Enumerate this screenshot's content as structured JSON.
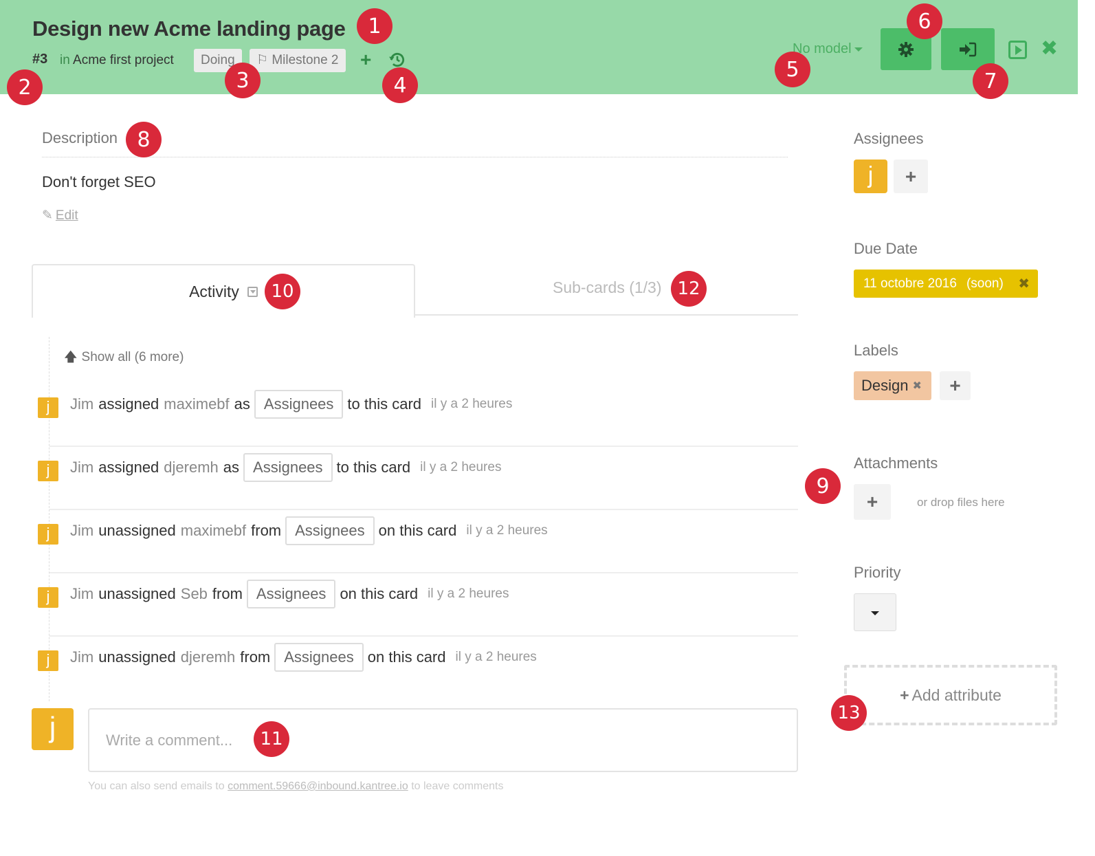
{
  "header": {
    "title": "Design new Acme landing page",
    "card_number": "#3",
    "project_prefix": "in",
    "project_name": "Acme first project",
    "status_tag": "Doing",
    "milestone_icon": "flag-icon",
    "milestone_tag": "Milestone 2",
    "add_icon": "plus-icon",
    "history_icon": "history-icon",
    "model_dropdown": "No model",
    "settings_icon": "gear-icon",
    "move_icon": "sign-in-icon",
    "present_icon": "play-square-icon",
    "close_icon": "close-icon",
    "background_color": "#97d9a8",
    "button_color": "#4cbd69"
  },
  "description": {
    "label": "Description",
    "text": "Don't forget SEO",
    "edit_label": "Edit",
    "edit_icon": "pencil-icon"
  },
  "tabs": [
    {
      "label": "Activity",
      "active": true,
      "icon": "filter-icon"
    },
    {
      "label": "Sub-cards (1/3)",
      "active": false
    }
  ],
  "activity": {
    "show_all": "Show all (6 more)",
    "items": [
      {
        "avatar": "j",
        "actor": "Jim",
        "verb": "assigned",
        "target": "maximebf",
        "prep": "as",
        "chip": "Assignees",
        "tail": "to this card",
        "time": "il y a 2 heures"
      },
      {
        "avatar": "j",
        "actor": "Jim",
        "verb": "assigned",
        "target": "djeremh",
        "prep": "as",
        "chip": "Assignees",
        "tail": "to this card",
        "time": "il y a 2 heures"
      },
      {
        "avatar": "j",
        "actor": "Jim",
        "verb": "unassigned",
        "target": "maximebf",
        "prep": "from",
        "chip": "Assignees",
        "tail": "on this card",
        "time": "il y a 2 heures"
      },
      {
        "avatar": "j",
        "actor": "Jim",
        "verb": "unassigned",
        "target": "Seb",
        "prep": "from",
        "chip": "Assignees",
        "tail": "on this card",
        "time": "il y a 2 heures"
      },
      {
        "avatar": "j",
        "actor": "Jim",
        "verb": "unassigned",
        "target": "djeremh",
        "prep": "from",
        "chip": "Assignees",
        "tail": "on this card",
        "time": "il y a 2 heures"
      }
    ]
  },
  "comment": {
    "avatar": "j",
    "placeholder": "Write a comment...",
    "value": "",
    "hint_prefix": "You can also send emails to",
    "hint_email": "comment.59666@inbound.kantree.io",
    "hint_suffix": "to leave comments"
  },
  "sidebar": {
    "assignees_label": "Assignees",
    "assignee_avatar": "j",
    "add_assignee": "+",
    "due_date_label": "Due Date",
    "due_date": "11 octobre 2016",
    "due_status": "(soon)",
    "due_remove": "✖",
    "due_color": "#e6c200",
    "labels_label": "Labels",
    "labels": [
      {
        "text": "Design",
        "color": "#f2c6a1",
        "remove": "✖"
      }
    ],
    "add_label": "+",
    "attachments_label": "Attachments",
    "add_attachment": "+",
    "drop_hint": "or drop files here",
    "priority_label": "Priority",
    "priority_value": "",
    "add_attribute": "Add attribute",
    "add_attribute_icon": "+"
  },
  "annotations": [
    "1",
    "2",
    "3",
    "4",
    "5",
    "6",
    "7",
    "8",
    "9",
    "10",
    "11",
    "12",
    "13"
  ]
}
